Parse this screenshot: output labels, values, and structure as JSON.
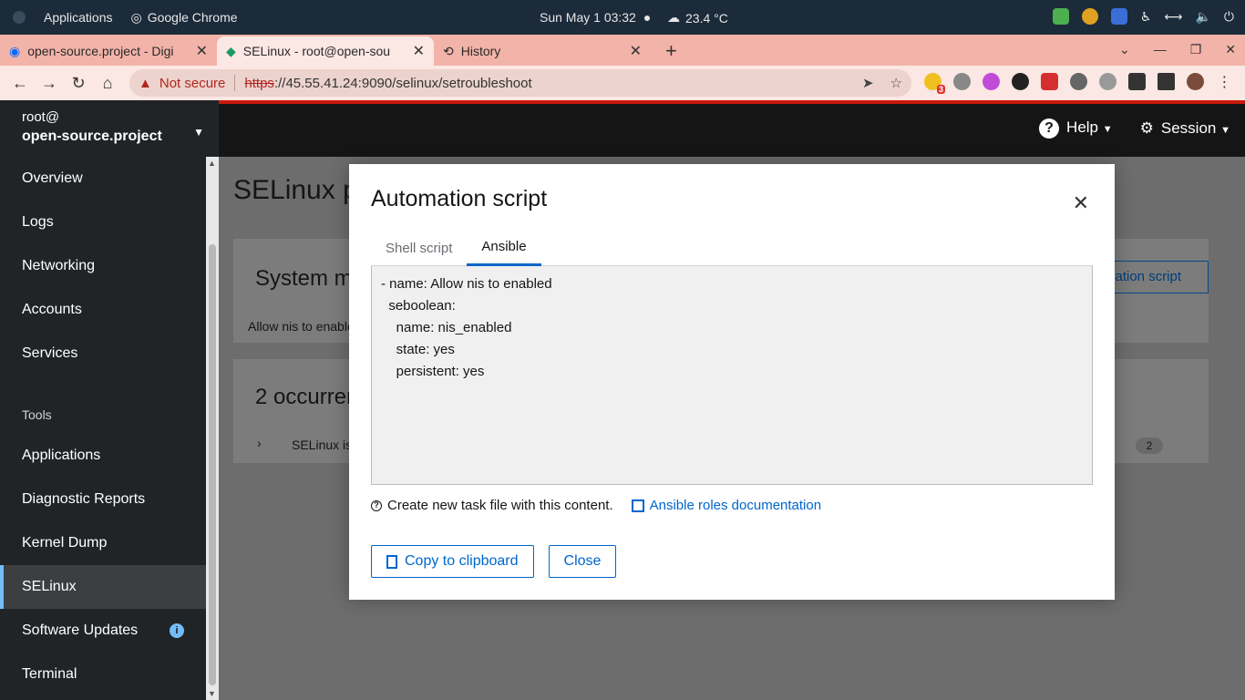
{
  "system_bar": {
    "applications": "Applications",
    "active_app": "Google Chrome",
    "datetime": "Sun May 1  03:32",
    "weather": "23.4 °C"
  },
  "browser": {
    "tabs": [
      {
        "title": "open-source.project - Digi"
      },
      {
        "title": "SELinux - root@open-sou"
      },
      {
        "title": "History"
      }
    ],
    "not_secure": "Not secure",
    "url_proto": "https",
    "url_rest": "://45.55.41.24:9090/selinux/setroubleshoot",
    "ext_badge": "3"
  },
  "header": {
    "user": "root@",
    "host": "open-source.project",
    "help": "Help",
    "session": "Session"
  },
  "sidebar": {
    "items_top": [
      {
        "label": "Overview"
      },
      {
        "label": "Logs"
      },
      {
        "label": "Networking"
      },
      {
        "label": "Accounts"
      },
      {
        "label": "Services"
      }
    ],
    "group": "Tools",
    "items_tools": [
      {
        "label": "Applications"
      },
      {
        "label": "Diagnostic Reports"
      },
      {
        "label": "Kernel Dump"
      },
      {
        "label": "SELinux"
      },
      {
        "label": "Software Updates"
      },
      {
        "label": "Terminal"
      }
    ]
  },
  "background": {
    "page_title": "SELinux p",
    "card1_title": "System m",
    "card1_sub": "Allow nis to enable",
    "card1_button": "mation script",
    "card2_title": "2 occurren",
    "card2_row": "SELinux is",
    "card2_badge": "2"
  },
  "modal": {
    "title": "Automation script",
    "tabs": [
      "Shell script",
      "Ansible"
    ],
    "code": "- name: Allow nis to enabled\n  seboolean:\n    name: nis_enabled\n    state: yes\n    persistent: yes",
    "helper": "Create new task file with this content.",
    "doc_link": "Ansible roles documentation",
    "copy_button": "Copy to clipboard",
    "close_button": "Close"
  }
}
